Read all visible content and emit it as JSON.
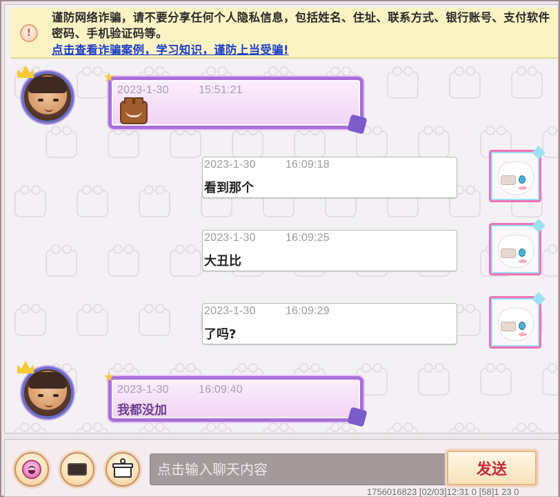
{
  "banner": {
    "warning_text": "谨防网络诈骗，请不要分享任何个人隐私信息，包括姓名、住址、联系方式、银行账号、支付软件密码、手机验证码等。",
    "link_text": "点击查看诈骗案例，学习知识，谨防上当受骗!"
  },
  "messages": [
    {
      "side": "left",
      "date": "2023-1-30",
      "time": "15:51:21",
      "text": "",
      "sticker": true
    },
    {
      "side": "right",
      "date": "2023-1-30",
      "time": "16:09:18",
      "text": "看到那个"
    },
    {
      "side": "right",
      "date": "2023-1-30",
      "time": "16:09:25",
      "text": "大丑比"
    },
    {
      "side": "right",
      "date": "2023-1-30",
      "time": "16:09:29",
      "text": "了吗?"
    },
    {
      "side": "left",
      "date": "2023-1-30",
      "time": "16:09:40",
      "text": "我都没加"
    }
  ],
  "input": {
    "placeholder": "点击输入聊天内容",
    "value": ""
  },
  "send_label": "发送",
  "status_line": "1756016823 [02/03]12:31 0 [58]1 23 0",
  "icons": {
    "banner": "warning-icon",
    "emoji_button": "emoji-icon",
    "keyboard_button": "keyboard-icon",
    "gift_button": "gift-icon"
  },
  "colors": {
    "banner_bg": "#fbf3c4",
    "link": "#1b3ec9",
    "send_text": "#c42a3b",
    "fancy_bubble_border": "#a86fd8"
  }
}
